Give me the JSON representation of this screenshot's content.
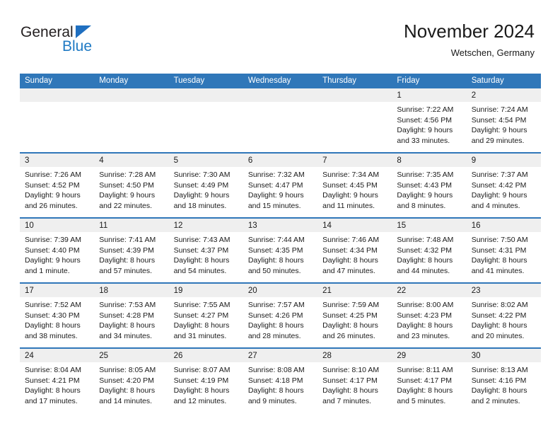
{
  "brand": {
    "line1": "General",
    "line2": "Blue",
    "accent_color": "#1f7ac4"
  },
  "header": {
    "title": "November 2024",
    "subtitle": "Wetschen, Germany"
  },
  "theme": {
    "header_blue": "#3077b9",
    "day_band_gray": "#efefef",
    "text": "#1a1a1a"
  },
  "calendar": {
    "weekdays": [
      "Sunday",
      "Monday",
      "Tuesday",
      "Wednesday",
      "Thursday",
      "Friday",
      "Saturday"
    ],
    "weeks": [
      [
        {
          "day": "",
          "lines": []
        },
        {
          "day": "",
          "lines": []
        },
        {
          "day": "",
          "lines": []
        },
        {
          "day": "",
          "lines": []
        },
        {
          "day": "",
          "lines": []
        },
        {
          "day": "1",
          "lines": [
            "Sunrise: 7:22 AM",
            "Sunset: 4:56 PM",
            "Daylight: 9 hours",
            "and 33 minutes."
          ]
        },
        {
          "day": "2",
          "lines": [
            "Sunrise: 7:24 AM",
            "Sunset: 4:54 PM",
            "Daylight: 9 hours",
            "and 29 minutes."
          ]
        }
      ],
      [
        {
          "day": "3",
          "lines": [
            "Sunrise: 7:26 AM",
            "Sunset: 4:52 PM",
            "Daylight: 9 hours",
            "and 26 minutes."
          ]
        },
        {
          "day": "4",
          "lines": [
            "Sunrise: 7:28 AM",
            "Sunset: 4:50 PM",
            "Daylight: 9 hours",
            "and 22 minutes."
          ]
        },
        {
          "day": "5",
          "lines": [
            "Sunrise: 7:30 AM",
            "Sunset: 4:49 PM",
            "Daylight: 9 hours",
            "and 18 minutes."
          ]
        },
        {
          "day": "6",
          "lines": [
            "Sunrise: 7:32 AM",
            "Sunset: 4:47 PM",
            "Daylight: 9 hours",
            "and 15 minutes."
          ]
        },
        {
          "day": "7",
          "lines": [
            "Sunrise: 7:34 AM",
            "Sunset: 4:45 PM",
            "Daylight: 9 hours",
            "and 11 minutes."
          ]
        },
        {
          "day": "8",
          "lines": [
            "Sunrise: 7:35 AM",
            "Sunset: 4:43 PM",
            "Daylight: 9 hours",
            "and 8 minutes."
          ]
        },
        {
          "day": "9",
          "lines": [
            "Sunrise: 7:37 AM",
            "Sunset: 4:42 PM",
            "Daylight: 9 hours",
            "and 4 minutes."
          ]
        }
      ],
      [
        {
          "day": "10",
          "lines": [
            "Sunrise: 7:39 AM",
            "Sunset: 4:40 PM",
            "Daylight: 9 hours",
            "and 1 minute."
          ]
        },
        {
          "day": "11",
          "lines": [
            "Sunrise: 7:41 AM",
            "Sunset: 4:39 PM",
            "Daylight: 8 hours",
            "and 57 minutes."
          ]
        },
        {
          "day": "12",
          "lines": [
            "Sunrise: 7:43 AM",
            "Sunset: 4:37 PM",
            "Daylight: 8 hours",
            "and 54 minutes."
          ]
        },
        {
          "day": "13",
          "lines": [
            "Sunrise: 7:44 AM",
            "Sunset: 4:35 PM",
            "Daylight: 8 hours",
            "and 50 minutes."
          ]
        },
        {
          "day": "14",
          "lines": [
            "Sunrise: 7:46 AM",
            "Sunset: 4:34 PM",
            "Daylight: 8 hours",
            "and 47 minutes."
          ]
        },
        {
          "day": "15",
          "lines": [
            "Sunrise: 7:48 AM",
            "Sunset: 4:32 PM",
            "Daylight: 8 hours",
            "and 44 minutes."
          ]
        },
        {
          "day": "16",
          "lines": [
            "Sunrise: 7:50 AM",
            "Sunset: 4:31 PM",
            "Daylight: 8 hours",
            "and 41 minutes."
          ]
        }
      ],
      [
        {
          "day": "17",
          "lines": [
            "Sunrise: 7:52 AM",
            "Sunset: 4:30 PM",
            "Daylight: 8 hours",
            "and 38 minutes."
          ]
        },
        {
          "day": "18",
          "lines": [
            "Sunrise: 7:53 AM",
            "Sunset: 4:28 PM",
            "Daylight: 8 hours",
            "and 34 minutes."
          ]
        },
        {
          "day": "19",
          "lines": [
            "Sunrise: 7:55 AM",
            "Sunset: 4:27 PM",
            "Daylight: 8 hours",
            "and 31 minutes."
          ]
        },
        {
          "day": "20",
          "lines": [
            "Sunrise: 7:57 AM",
            "Sunset: 4:26 PM",
            "Daylight: 8 hours",
            "and 28 minutes."
          ]
        },
        {
          "day": "21",
          "lines": [
            "Sunrise: 7:59 AM",
            "Sunset: 4:25 PM",
            "Daylight: 8 hours",
            "and 26 minutes."
          ]
        },
        {
          "day": "22",
          "lines": [
            "Sunrise: 8:00 AM",
            "Sunset: 4:23 PM",
            "Daylight: 8 hours",
            "and 23 minutes."
          ]
        },
        {
          "day": "23",
          "lines": [
            "Sunrise: 8:02 AM",
            "Sunset: 4:22 PM",
            "Daylight: 8 hours",
            "and 20 minutes."
          ]
        }
      ],
      [
        {
          "day": "24",
          "lines": [
            "Sunrise: 8:04 AM",
            "Sunset: 4:21 PM",
            "Daylight: 8 hours",
            "and 17 minutes."
          ]
        },
        {
          "day": "25",
          "lines": [
            "Sunrise: 8:05 AM",
            "Sunset: 4:20 PM",
            "Daylight: 8 hours",
            "and 14 minutes."
          ]
        },
        {
          "day": "26",
          "lines": [
            "Sunrise: 8:07 AM",
            "Sunset: 4:19 PM",
            "Daylight: 8 hours",
            "and 12 minutes."
          ]
        },
        {
          "day": "27",
          "lines": [
            "Sunrise: 8:08 AM",
            "Sunset: 4:18 PM",
            "Daylight: 8 hours",
            "and 9 minutes."
          ]
        },
        {
          "day": "28",
          "lines": [
            "Sunrise: 8:10 AM",
            "Sunset: 4:17 PM",
            "Daylight: 8 hours",
            "and 7 minutes."
          ]
        },
        {
          "day": "29",
          "lines": [
            "Sunrise: 8:11 AM",
            "Sunset: 4:17 PM",
            "Daylight: 8 hours",
            "and 5 minutes."
          ]
        },
        {
          "day": "30",
          "lines": [
            "Sunrise: 8:13 AM",
            "Sunset: 4:16 PM",
            "Daylight: 8 hours",
            "and 2 minutes."
          ]
        }
      ]
    ]
  }
}
